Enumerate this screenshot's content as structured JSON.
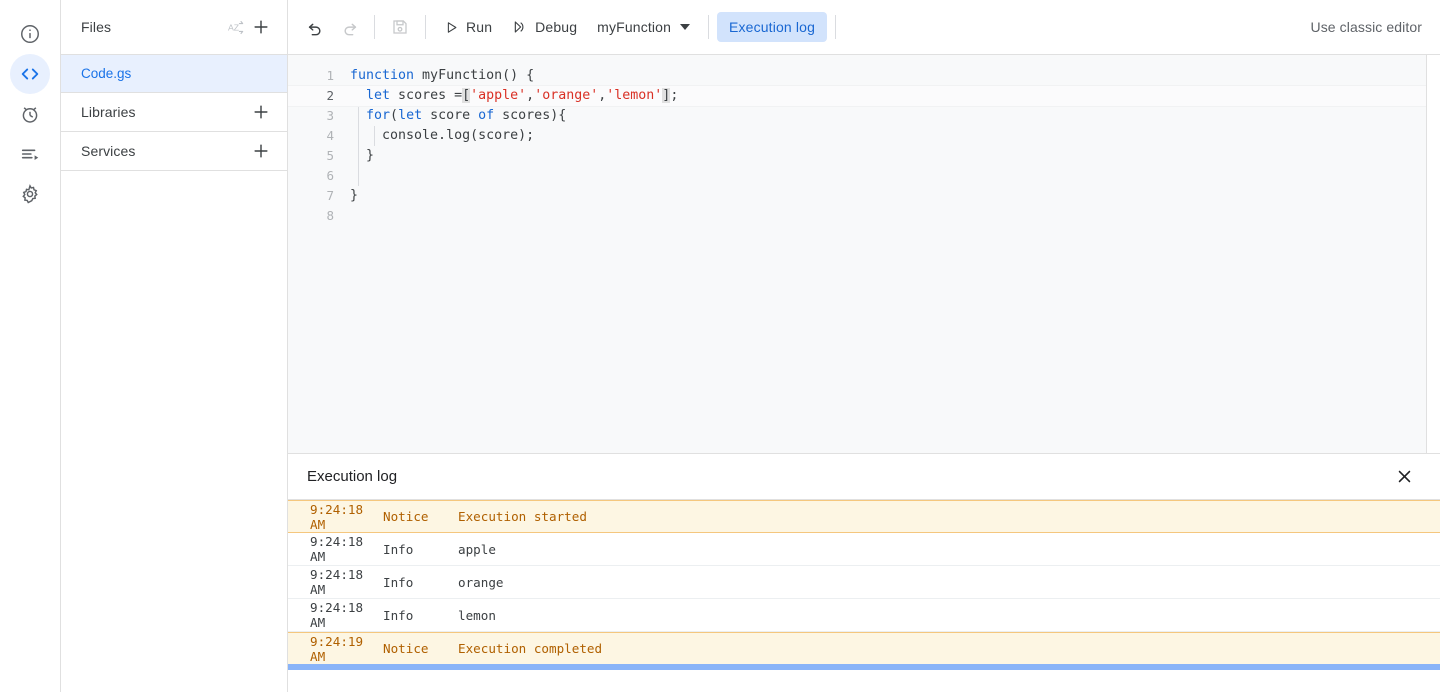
{
  "rail": {
    "items": [
      {
        "name": "overview-icon",
        "label": "Overview"
      },
      {
        "name": "editor-icon",
        "label": "Editor",
        "selected": true
      },
      {
        "name": "triggers-icon",
        "label": "Triggers"
      },
      {
        "name": "executions-icon",
        "label": "Executions"
      },
      {
        "name": "settings-icon",
        "label": "Project Settings"
      }
    ]
  },
  "sidebar": {
    "files": {
      "title": "Files",
      "sort_icon": "sort-az-icon",
      "add_icon": "add-icon",
      "items": [
        {
          "name": "Code.gs",
          "active": true
        }
      ]
    },
    "libraries": {
      "title": "Libraries",
      "add_icon": "add-icon"
    },
    "services": {
      "title": "Services",
      "add_icon": "add-icon"
    }
  },
  "toolbar": {
    "undo_label": "Undo",
    "redo_label": "Redo",
    "save_label": "Save project",
    "run_label": "Run",
    "debug_label": "Debug",
    "function_selected": "myFunction",
    "execution_log_label": "Execution log",
    "classic_editor_label": "Use classic editor",
    "accent_color": "#1a73e8",
    "pill_bg": "#d2e3fc",
    "pill_fg": "#1967d2"
  },
  "editor": {
    "filename": "Code.gs",
    "active_line": 2,
    "lines": [
      {
        "n": "1",
        "tokens": [
          {
            "t": "function",
            "c": "kw"
          },
          {
            "t": " myFunction() {",
            "c": ""
          }
        ]
      },
      {
        "n": "2",
        "tokens": [
          {
            "t": "  ",
            "c": ""
          },
          {
            "t": "let",
            "c": "kw"
          },
          {
            "t": " scores =",
            "c": ""
          },
          {
            "t": "[",
            "c": "brk"
          },
          {
            "t": "'apple'",
            "c": "str"
          },
          {
            "t": ",",
            "c": ""
          },
          {
            "t": "'orange'",
            "c": "str"
          },
          {
            "t": ",",
            "c": ""
          },
          {
            "t": "'lemon'",
            "c": "str"
          },
          {
            "t": "]",
            "c": "brk"
          },
          {
            "t": ";",
            "c": ""
          }
        ]
      },
      {
        "n": "3",
        "tokens": [
          {
            "t": "  ",
            "c": ""
          },
          {
            "t": "for",
            "c": "kw"
          },
          {
            "t": "(",
            "c": ""
          },
          {
            "t": "let",
            "c": "kw"
          },
          {
            "t": " score ",
            "c": ""
          },
          {
            "t": "of",
            "c": "kw"
          },
          {
            "t": " scores){",
            "c": ""
          }
        ]
      },
      {
        "n": "4",
        "tokens": [
          {
            "t": "    console.log(score);",
            "c": ""
          }
        ]
      },
      {
        "n": "5",
        "tokens": [
          {
            "t": "  }",
            "c": ""
          }
        ]
      },
      {
        "n": "6",
        "tokens": [
          {
            "t": "",
            "c": ""
          }
        ]
      },
      {
        "n": "7",
        "tokens": [
          {
            "t": "}",
            "c": ""
          }
        ]
      },
      {
        "n": "8",
        "tokens": [
          {
            "t": "",
            "c": ""
          }
        ]
      }
    ],
    "colors": {
      "background": "#f8f9fa",
      "keyword": "#1967d2",
      "string": "#d93025",
      "text": "#3c4043",
      "linenum": "#b0b3b6"
    }
  },
  "log": {
    "title": "Execution log",
    "close_icon": "close-icon",
    "rows": [
      {
        "time": "9:24:18 AM",
        "level": "Notice",
        "message": "Execution started",
        "kind": "notice"
      },
      {
        "time": "9:24:18 AM",
        "level": "Info",
        "message": "apple",
        "kind": "info"
      },
      {
        "time": "9:24:18 AM",
        "level": "Info",
        "message": "orange",
        "kind": "info"
      },
      {
        "time": "9:24:18 AM",
        "level": "Info",
        "message": "lemon",
        "kind": "info"
      },
      {
        "time": "9:24:19 AM",
        "level": "Notice",
        "message": "Execution completed",
        "kind": "notice"
      }
    ],
    "notice_bg": "#fdf6e3",
    "notice_fg": "#b06000",
    "scrollbar_color": "#8ab4f8"
  }
}
